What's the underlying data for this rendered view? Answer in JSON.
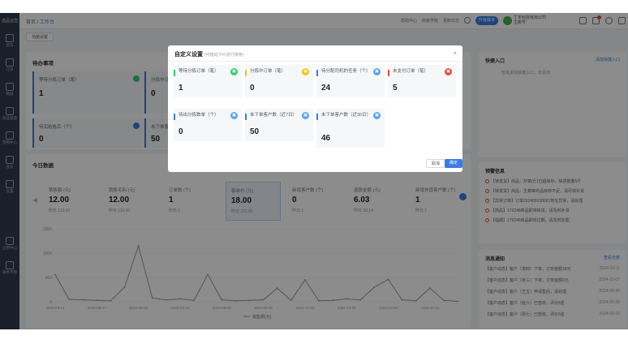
{
  "sidebar": {
    "logo": "选品运营",
    "items": [
      {
        "label": "首页",
        "icon": "home-icon"
      },
      {
        "label": "订单",
        "icon": "order-icon"
      },
      {
        "label": "数据",
        "icon": "chart-icon"
      },
      {
        "label": "商品管理",
        "icon": "goods-icon"
      },
      {
        "label": "营销中心",
        "icon": "marketing-icon"
      },
      {
        "label": "会员",
        "icon": "member-icon"
      },
      {
        "label": "设置",
        "icon": "settings-icon"
      },
      {
        "label": "应用中心",
        "icon": "apps-icon"
      },
      {
        "label": "服务市场",
        "icon": "service-icon"
      }
    ]
  },
  "topbar": {
    "crumb_home": "首页",
    "crumb_current": "工作台",
    "links": [
      "帮助中心",
      "商家学院",
      "更新日志"
    ],
    "badge": "升级版本",
    "user_line1": "丁冬科技有限公司",
    "user_line2": "主账号"
  },
  "tab": {
    "label": "功能设置"
  },
  "pending": {
    "title": "待办事项",
    "cards": [
      {
        "title": "等待分拣订单（笔）",
        "value": "1",
        "color": "#3a7be8"
      },
      {
        "title": "分拣中订单（笔）",
        "value": "0",
        "color": "#2ecc71"
      },
      {
        "title": "待完结售后（个）",
        "value": "0",
        "color": "#3a7be8"
      },
      {
        "title": "未下单客户（人）",
        "value": "50",
        "color": "#2ecc71"
      }
    ]
  },
  "today": {
    "title": "今日数据",
    "stats": [
      {
        "title": "销售额 (元)",
        "value": "12.00",
        "prev": "昨日 110.00"
      },
      {
        "title": "销售毛利 (元)",
        "value": "12.00",
        "prev": "昨日 110.00"
      },
      {
        "title": "订单数 (个)",
        "value": "1",
        "prev": "昨日 1"
      },
      {
        "title": "客单价 (元)",
        "value": "18.00",
        "prev": "昨日 110.00"
      },
      {
        "title": "新增客户数 (个)",
        "value": "0",
        "prev": "昨日 1"
      },
      {
        "title": "退款金额 (元)",
        "value": "6.03",
        "prev": "昨日 28.14"
      },
      {
        "title": "新增充值客户数 (个)",
        "value": "1",
        "prev": "昨日 1"
      }
    ]
  },
  "chart_data": {
    "type": "line",
    "x": [
      "2024-09-14",
      "2024-09-15",
      "2024-09-16",
      "2024-09-17",
      "2024-09-18",
      "2024-09-19",
      "2024-09-20",
      "2024-09-21",
      "2024-09-22",
      "2024-09-23",
      "2024-09-24",
      "2024-09-25",
      "2024-09-26",
      "2024-09-27",
      "2024-09-28",
      "2024-09-29",
      "2024-09-30",
      "2024-10-01",
      "2024-10-02",
      "2024-10-03",
      "2024-10-04",
      "2024-10-05",
      "2024-10-06",
      "2024-10-07",
      "2024-10-08",
      "2024-10-09",
      "2024-10-10",
      "2024-10-11",
      "2024-10-12",
      "2024-10-13"
    ],
    "xticks": [
      "2024-09-14",
      "2024-09-17",
      "2024-09-20",
      "2024-09-23",
      "2024-09-26",
      "2024-09-29",
      "2024-10-02",
      "2024-10-05",
      "2024-10-08",
      "2024-10-11"
    ],
    "yticks": [
      "1500",
      "1000",
      "500",
      "0"
    ],
    "ylim": [
      0,
      1500
    ],
    "series": [
      {
        "name": "销售额(元)",
        "color": "#8c99ab",
        "values": [
          560,
          50,
          40,
          30,
          20,
          300,
          1150,
          80,
          40,
          60,
          30,
          560,
          40,
          20,
          30,
          40,
          280,
          30,
          450,
          20,
          30,
          60,
          40,
          300,
          460,
          40,
          20,
          280,
          30,
          10
        ]
      }
    ]
  },
  "notice": {
    "title": "快捷入口",
    "link": "添加快捷入口",
    "empty": "暂未添加快捷入口，去添加"
  },
  "warnings": {
    "title": "预警信息",
    "rows": [
      "【待发货】商品：芹菜(斤)已超库存，缺货数量5斤",
      "【待发货】商品：生菜等商品库存不足，请尽快补货",
      "【异常订单】订单202409130001地址异常，请处理",
      "【商品】179248商品即将缺货，请及时补货",
      "【临期】179248商品即将过期，请及时处理"
    ]
  },
  "news": {
    "title": "消息通知",
    "link": "查看全部",
    "rows": [
      {
        "text": "【客户动态】客户（李四）下单，订单金额18元",
        "date": "2024-10-11"
      },
      {
        "text": "【客户动态】客户（张三）下单，订单金额6元",
        "date": "2024-10-07"
      },
      {
        "text": "【客户动态】客户（王五）申请售后，请处理",
        "date": "2024-09-30"
      },
      {
        "text": "【客户动态】客户（赵六）已签收，评价5星",
        "date": "2024-09-26"
      },
      {
        "text": "【客户动态】客户（周七）已签收，评价5星",
        "date": "2024-09-26"
      }
    ]
  },
  "modal": {
    "title": "自定义设置",
    "hint": "(可拖动卡片进行排序)",
    "cards": [
      {
        "title": "等待分拣订单（笔）",
        "value": "1",
        "color": "#2ecc71",
        "icon": "sort-icon"
      },
      {
        "title": "分拣中订单（笔）",
        "value": "0",
        "color": "#f1c40f",
        "icon": "sorting-icon"
      },
      {
        "title": "待分配司机的任务（个）",
        "value": "24",
        "color": "#3a7be8",
        "icon": "driver-icon"
      },
      {
        "title": "未支付订单（笔）",
        "value": "5",
        "color": "#e74c3c",
        "icon": "unpaid-icon"
      },
      {
        "title": "待出分拣数单（个）",
        "value": "0",
        "color": "#3a7be8",
        "icon": "list-icon"
      },
      {
        "title": "未下单客户数（近7日）",
        "value": "50",
        "color": "#3a7be8",
        "icon": "customer-icon"
      },
      {
        "title": "未下单客户数（近30日）",
        "value": "46",
        "color": "#3a7be8",
        "icon": "customer30-icon"
      }
    ],
    "cancel": "取消",
    "ok": "确定"
  }
}
